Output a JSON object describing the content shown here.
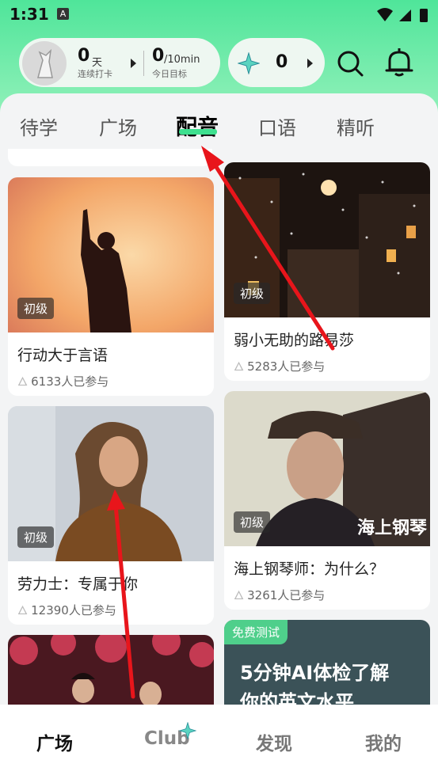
{
  "status_bar": {
    "time": "1:31",
    "sim_label": "A"
  },
  "stats": {
    "streak_value": "0",
    "streak_unit": "天",
    "streak_label": "连续打卡",
    "goal_value": "0",
    "goal_unit": "/10min",
    "goal_label": "今日目标",
    "gem_value": "0"
  },
  "tabs": [
    {
      "label": "待学"
    },
    {
      "label": "广场"
    },
    {
      "label": "配音",
      "active": true
    },
    {
      "label": "口语"
    },
    {
      "label": "精听"
    }
  ],
  "cards": [
    {
      "title": "行动大于言语",
      "level": "初级",
      "participants": "6133人已参与"
    },
    {
      "title": "弱小无助的路易莎",
      "level": "初级",
      "participants": "5283人已参与"
    },
    {
      "title": "劳力士：专属于你",
      "level": "初级",
      "participants": "12390人已参与"
    },
    {
      "title": "海上钢琴师：为什么？",
      "level": "初级",
      "participants": "3261人已参与",
      "poster_text": "海上钢琴"
    },
    {
      "badge": "免费测试",
      "promo_line1": "5分钟AI体检了解",
      "promo_line2": "你的英文水平"
    }
  ],
  "bottom_nav": [
    {
      "label": "广场",
      "active": true
    },
    {
      "label": "Club"
    },
    {
      "label": "发现"
    },
    {
      "label": "我的"
    }
  ],
  "colors": {
    "accent": "#3ee08f",
    "annotation_arrow": "#e8151b"
  }
}
